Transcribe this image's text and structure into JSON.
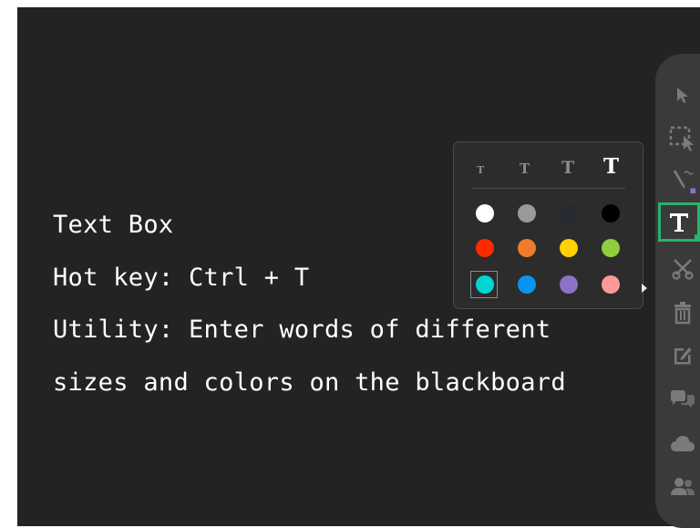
{
  "info": {
    "lines": [
      "Text Box",
      "Hot key: Ctrl + T",
      "Utility: Enter words of different",
      "sizes and colors on the blackboard"
    ]
  },
  "text_panel": {
    "size_options": [
      "T",
      "T",
      "T",
      "T"
    ],
    "selected_size_index": 3,
    "colors": [
      "#ffffff",
      "#9a9a9a",
      "#262a31",
      "#000000",
      "#ff2a00",
      "#ef7b2b",
      "#ffd100",
      "#8fce3e",
      "#00d5d1",
      "#0a93ef",
      "#8b72c9",
      "#ff9999"
    ],
    "selected_color_index": 8
  },
  "toolbar": {
    "tools": [
      "select-tool-icon",
      "area-select-icon",
      "pen-icon",
      "text-tool-icon",
      "scissors-icon",
      "trash-icon",
      "edit-icon",
      "chat-icon",
      "cloud-icon",
      "users-icon"
    ],
    "active_tool": "text-tool-icon",
    "accent_color": "#27b36a"
  }
}
